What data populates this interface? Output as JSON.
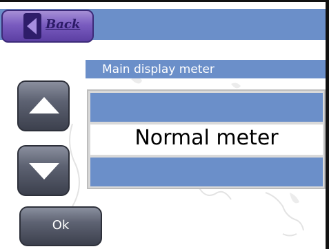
{
  "header": {
    "back_label": "Back"
  },
  "section": {
    "title": "Main display meter"
  },
  "list": {
    "previous_option": "",
    "selected_option": "Normal meter",
    "next_option": ""
  },
  "buttons": {
    "ok_label": "Ok"
  },
  "icons": {
    "back": "back-arrow-icon",
    "up": "up-arrow-icon",
    "down": "down-arrow-icon"
  },
  "colors": {
    "bar_blue": "#6b8fc9",
    "back_button_purple": "#7a5cc0",
    "nav_button_gray": "#5d6272"
  }
}
